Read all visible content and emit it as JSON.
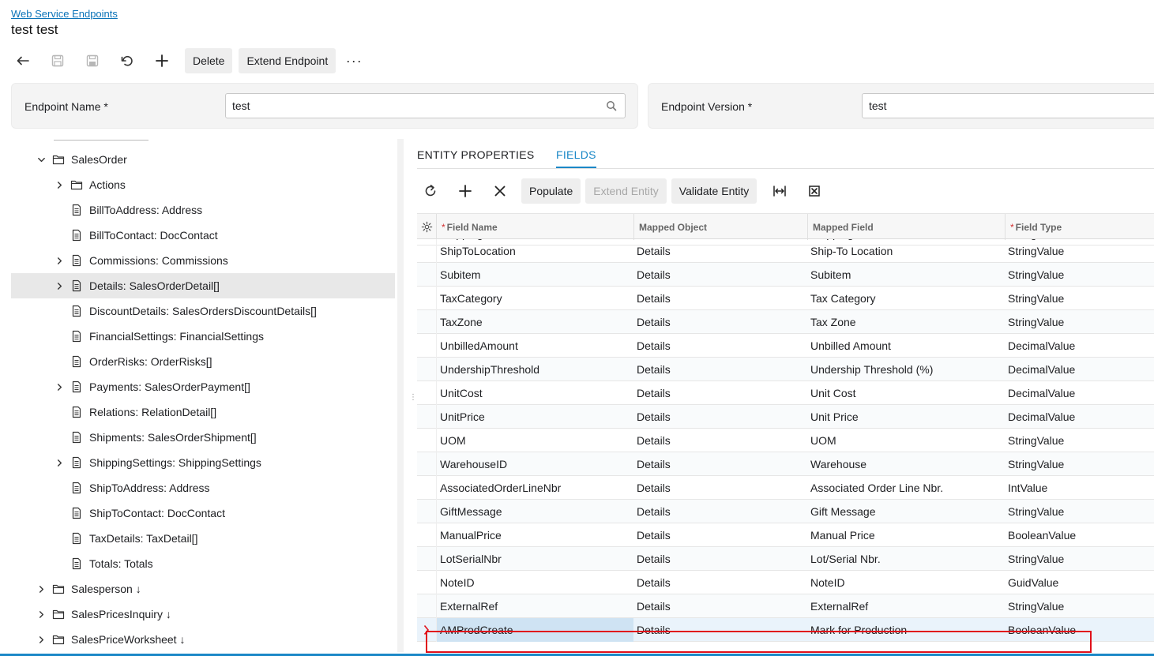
{
  "breadcrumb": "Web Service Endpoints",
  "title": "test test",
  "toolbar": {
    "delete_label": "Delete",
    "extend_endpoint_label": "Extend Endpoint",
    "more_label": "···"
  },
  "form": {
    "endpoint_name_label": "Endpoint Name",
    "endpoint_name_value": "test",
    "endpoint_version_label": "Endpoint Version",
    "endpoint_version_value": "test",
    "required_mark": "*"
  },
  "tree": {
    "items": [
      {
        "label": "SalesOrder",
        "level": 1,
        "expanded": true,
        "icon": "folder-icon"
      },
      {
        "label": "Actions",
        "level": 2,
        "expandable": true,
        "icon": "folder-icon"
      },
      {
        "label": "BillToAddress: Address",
        "level": 2,
        "icon": "document-icon"
      },
      {
        "label": "BillToContact: DocContact",
        "level": 2,
        "icon": "document-icon"
      },
      {
        "label": "Commissions: Commissions",
        "level": 2,
        "expandable": true,
        "icon": "document-icon"
      },
      {
        "label": "Details: SalesOrderDetail[]",
        "level": 2,
        "expandable": true,
        "icon": "document-icon",
        "selected": true
      },
      {
        "label": "DiscountDetails: SalesOrdersDiscountDetails[]",
        "level": 2,
        "icon": "document-icon"
      },
      {
        "label": "FinancialSettings: FinancialSettings",
        "level": 2,
        "icon": "document-icon"
      },
      {
        "label": "OrderRisks: OrderRisks[]",
        "level": 2,
        "icon": "document-icon"
      },
      {
        "label": "Payments: SalesOrderPayment[]",
        "level": 2,
        "expandable": true,
        "icon": "document-icon"
      },
      {
        "label": "Relations: RelationDetail[]",
        "level": 2,
        "icon": "document-icon"
      },
      {
        "label": "Shipments: SalesOrderShipment[]",
        "level": 2,
        "icon": "document-icon"
      },
      {
        "label": "ShippingSettings: ShippingSettings",
        "level": 2,
        "expandable": true,
        "icon": "document-icon"
      },
      {
        "label": "ShipToAddress: Address",
        "level": 2,
        "icon": "document-icon"
      },
      {
        "label": "ShipToContact: DocContact",
        "level": 2,
        "icon": "document-icon"
      },
      {
        "label": "TaxDetails: TaxDetail[]",
        "level": 2,
        "icon": "document-icon"
      },
      {
        "label": "Totals: Totals",
        "level": 2,
        "icon": "document-icon"
      },
      {
        "label": "Salesperson ↓",
        "level": 1,
        "expandable": true,
        "icon": "folder-icon"
      },
      {
        "label": "SalesPricesInquiry ↓",
        "level": 1,
        "expandable": true,
        "icon": "folder-icon"
      },
      {
        "label": "SalesPriceWorksheet ↓",
        "level": 1,
        "expandable": true,
        "icon": "folder-icon"
      }
    ]
  },
  "tabs": [
    {
      "label": "ENTITY PROPERTIES",
      "active": false
    },
    {
      "label": "FIELDS",
      "active": true
    }
  ],
  "grid_toolbar": {
    "populate_label": "Populate",
    "extend_entity_label": "Extend Entity",
    "validate_entity_label": "Validate Entity"
  },
  "grid": {
    "columns": [
      {
        "label": "Field Name",
        "required": true
      },
      {
        "label": "Mapped Object",
        "required": false
      },
      {
        "label": "Mapped Field",
        "required": false
      },
      {
        "label": "Field Type",
        "required": true
      }
    ],
    "partial_row": [
      "ShippingRule",
      "Details",
      "Shipping Rule",
      "StringValue"
    ],
    "rows": [
      [
        "ShipToLocation",
        "Details",
        "Ship-To Location",
        "StringValue"
      ],
      [
        "Subitem",
        "Details",
        "Subitem",
        "StringValue"
      ],
      [
        "TaxCategory",
        "Details",
        "Tax Category",
        "StringValue"
      ],
      [
        "TaxZone",
        "Details",
        "Tax Zone",
        "StringValue"
      ],
      [
        "UnbilledAmount",
        "Details",
        "Unbilled Amount",
        "DecimalValue"
      ],
      [
        "UndershipThreshold",
        "Details",
        "Undership Threshold (%)",
        "DecimalValue"
      ],
      [
        "UnitCost",
        "Details",
        "Unit Cost",
        "DecimalValue"
      ],
      [
        "UnitPrice",
        "Details",
        "Unit Price",
        "DecimalValue"
      ],
      [
        "UOM",
        "Details",
        "UOM",
        "StringValue"
      ],
      [
        "WarehouseID",
        "Details",
        "Warehouse",
        "StringValue"
      ],
      [
        "AssociatedOrderLineNbr",
        "Details",
        "Associated Order Line Nbr.",
        "IntValue"
      ],
      [
        "GiftMessage",
        "Details",
        "Gift Message",
        "StringValue"
      ],
      [
        "ManualPrice",
        "Details",
        "Manual Price",
        "BooleanValue"
      ],
      [
        "LotSerialNbr",
        "Details",
        "Lot/Serial Nbr.",
        "StringValue"
      ],
      [
        "NoteID",
        "Details",
        "NoteID",
        "GuidValue"
      ],
      [
        "ExternalRef",
        "Details",
        "ExternalRef",
        "StringValue"
      ],
      [
        "AMProdCreate",
        "Details",
        "Mark for Production",
        "BooleanValue"
      ]
    ],
    "selected_row": 16
  },
  "colors": {
    "accent": "#1b88c7",
    "highlight": "#e0101a"
  }
}
